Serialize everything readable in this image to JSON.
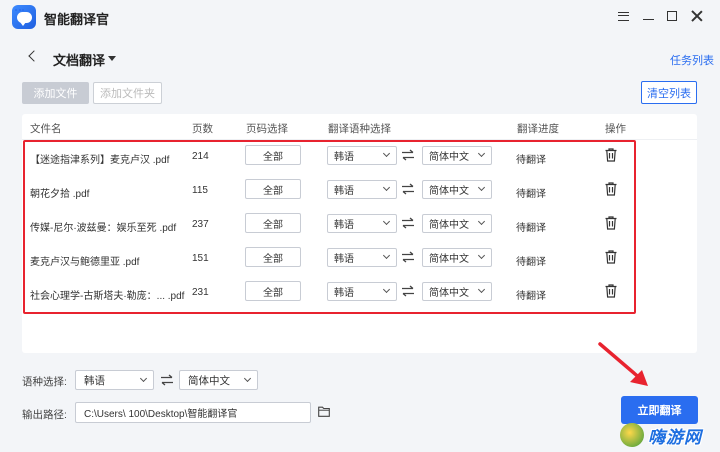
{
  "app": {
    "title": "智能翻译官"
  },
  "header": {
    "title": "文档翻译",
    "task_list": "任务列表"
  },
  "toolbar": {
    "add_file": "添加文件",
    "add_folder": "添加文件夹",
    "clear_list": "清空列表"
  },
  "table": {
    "headers": {
      "name": "文件名",
      "pages": "页数",
      "range": "页码选择",
      "lang": "翻译语种选择",
      "progress": "翻译进度",
      "ops": "操作"
    },
    "rows": [
      {
        "name": "【迷途指津系列】麦克卢汉 .pdf",
        "pages": "214",
        "range": "全部",
        "source": "韩语",
        "target": "简体中文",
        "status": "待翻译"
      },
      {
        "name": "朝花夕拾 .pdf",
        "pages": "115",
        "range": "全部",
        "source": "韩语",
        "target": "简体中文",
        "status": "待翻译"
      },
      {
        "name": "传媒-尼尔·波兹曼：娱乐至死 .pdf",
        "pages": "237",
        "range": "全部",
        "source": "韩语",
        "target": "简体中文",
        "status": "待翻译"
      },
      {
        "name": "麦克卢汉与鲍德里亚 .pdf",
        "pages": "151",
        "range": "全部",
        "source": "韩语",
        "target": "简体中文",
        "status": "待翻译"
      },
      {
        "name": "社会心理学-古斯塔夫·勒庞：...    .pdf",
        "pages": "231",
        "range": "全部",
        "source": "韩语",
        "target": "简体中文",
        "status": "待翻译"
      }
    ]
  },
  "bottom": {
    "lang_label": "语种选择:",
    "source": "韩语",
    "target": "简体中文",
    "path_label": "输出路径:",
    "path_value": "C:\\Users\\      100\\Desktop\\智能翻译官",
    "translate_button": "立即翻译"
  },
  "watermark": {
    "text": "嗨游网"
  },
  "colors": {
    "accent": "#2a6df0",
    "highlight": "#e8232f"
  },
  "icons": [
    "app-logo-icon",
    "menu-icon",
    "minimize-icon",
    "maximize-icon",
    "close-icon",
    "back-chevron-icon",
    "caret-down-icon",
    "swap-arrows-icon",
    "trash-icon",
    "folder-icon",
    "red-arrow-icon"
  ]
}
